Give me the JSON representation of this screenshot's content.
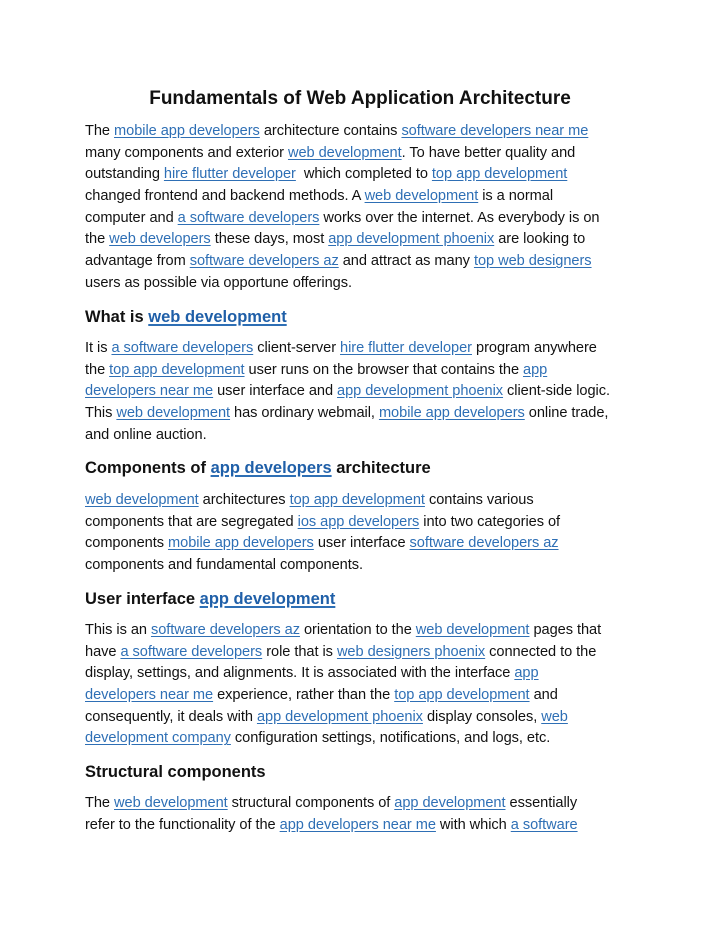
{
  "document": {
    "title": "Fundamentals of Web Application Architecture",
    "link_color": "#2e6fb5",
    "sections": [
      {
        "heading": null,
        "lines": [
          [
            {
              "t": "The "
            },
            {
              "l": "mobile app developers"
            },
            {
              "t": " architecture contains "
            },
            {
              "l": "software developers near me"
            }
          ],
          [
            {
              "t": "many components and exterior "
            },
            {
              "l": "web development"
            },
            {
              "t": ". To have better quality and"
            }
          ],
          [
            {
              "t": "outstanding "
            },
            {
              "l": "hire flutter developer"
            },
            {
              "t": "  which completed to "
            },
            {
              "l": "top app development"
            }
          ],
          [
            {
              "t": "changed frontend and backend methods. A "
            },
            {
              "l": "web development"
            },
            {
              "t": " is a normal"
            }
          ],
          [
            {
              "t": "computer and "
            },
            {
              "l": "a software developers"
            },
            {
              "t": " works over the internet. As everybody is on"
            }
          ],
          [
            {
              "t": "the "
            },
            {
              "l": "web developers"
            },
            {
              "t": " these days, most "
            },
            {
              "l": "app development phoenix"
            },
            {
              "t": " are looking to"
            }
          ],
          [
            {
              "t": "advantage from "
            },
            {
              "l": "software developers az"
            },
            {
              "t": " and attract as many "
            },
            {
              "l": "top web designers"
            }
          ],
          [
            {
              "t": "users as possible via opportune offerings."
            }
          ]
        ]
      },
      {
        "heading": [
          {
            "t": "What is "
          },
          {
            "l": "web development"
          }
        ],
        "lines": [
          [
            {
              "t": "It is "
            },
            {
              "l": "a software developers"
            },
            {
              "t": " client-server "
            },
            {
              "l": "hire flutter developer"
            },
            {
              "t": " program anywhere"
            }
          ],
          [
            {
              "t": "the "
            },
            {
              "l": "top app development"
            },
            {
              "t": " user runs on the browser that contains the "
            },
            {
              "l": "app"
            }
          ],
          [
            {
              "l": "developers near me"
            },
            {
              "t": " user interface and "
            },
            {
              "l": "app development phoenix"
            },
            {
              "t": " client-side logic."
            }
          ],
          [
            {
              "t": "This "
            },
            {
              "l": "web development"
            },
            {
              "t": " has ordinary webmail, "
            },
            {
              "l": "mobile app developers"
            },
            {
              "t": " online trade,"
            }
          ],
          [
            {
              "t": "and online auction."
            }
          ]
        ]
      },
      {
        "heading": [
          {
            "t": "Components of "
          },
          {
            "l": "app developers"
          },
          {
            "t": " architecture"
          }
        ],
        "lines": [
          [
            {
              "l": "web development"
            },
            {
              "t": " architectures "
            },
            {
              "l": "top app development"
            },
            {
              "t": " contains various"
            }
          ],
          [
            {
              "t": "components that are segregated "
            },
            {
              "l": "ios app developers"
            },
            {
              "t": " into two categories of"
            }
          ],
          [
            {
              "t": "components "
            },
            {
              "l": "mobile app developers"
            },
            {
              "t": " user interface "
            },
            {
              "l": "software developers az"
            }
          ],
          [
            {
              "t": "components and fundamental components."
            }
          ]
        ]
      },
      {
        "heading": [
          {
            "t": "User interface "
          },
          {
            "l": "app development"
          }
        ],
        "lines": [
          [
            {
              "t": "This is an "
            },
            {
              "l": "software developers az"
            },
            {
              "t": " orientation to the "
            },
            {
              "l": "web development"
            },
            {
              "t": " pages that"
            }
          ],
          [
            {
              "t": "have "
            },
            {
              "l": "a software developers"
            },
            {
              "t": " role that is "
            },
            {
              "l": "web designers phoenix"
            },
            {
              "t": " connected to the"
            }
          ],
          [
            {
              "t": "display, settings, and alignments. It is associated with the interface "
            },
            {
              "l": "app"
            }
          ],
          [
            {
              "l": "developers near me"
            },
            {
              "t": " experience, rather than the "
            },
            {
              "l": "top app development"
            },
            {
              "t": " and"
            }
          ],
          [
            {
              "t": "consequently, it deals with "
            },
            {
              "l": "app development phoenix"
            },
            {
              "t": " display consoles, "
            },
            {
              "l": "web"
            }
          ],
          [
            {
              "l": "development company"
            },
            {
              "t": " configuration settings, notifications, and logs, etc."
            }
          ]
        ]
      },
      {
        "heading": [
          {
            "t": "Structural components"
          }
        ],
        "lines": [
          [
            {
              "t": "The "
            },
            {
              "l": "web development"
            },
            {
              "t": " structural components of "
            },
            {
              "l": "app development"
            },
            {
              "t": " essentially"
            }
          ],
          [
            {
              "t": "refer to the functionality of the "
            },
            {
              "l": "app developers near me"
            },
            {
              "t": " with which "
            },
            {
              "l": "a software"
            }
          ]
        ]
      }
    ]
  }
}
